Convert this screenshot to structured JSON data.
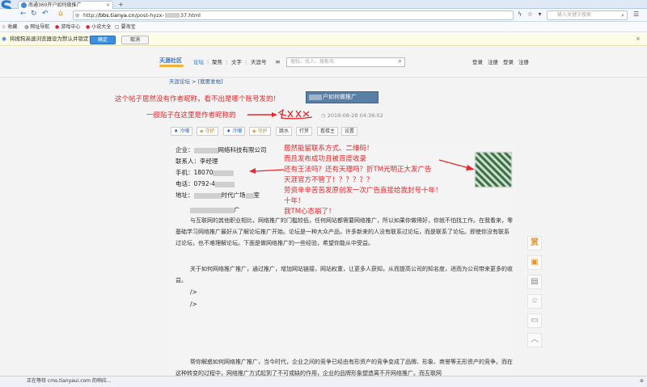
{
  "browser": {
    "tab_title": "南通360开户如何做推广",
    "new_tab": "+",
    "url_prefix": "http://",
    "url_domain": "bbs.tianya.cn",
    "url_path": "/post-hyzx-",
    "url_suffix": "37.html",
    "search_placeholder": "输入关键字搜索",
    "nav_back": "←",
    "nav_forward": "→",
    "nav_refresh": "↻",
    "nav_undo": "↶",
    "nav_home": "⌂"
  },
  "bookmarks": [
    {
      "label": "收藏"
    },
    {
      "label": "网址导航"
    },
    {
      "label": "游戏中心"
    },
    {
      "label": "小说大全"
    },
    {
      "label": "要淘宝"
    }
  ],
  "infobar": {
    "message": "将搜狗高速浏览器设为默认并锁定？",
    "ok_label": "确定",
    "cancel_label": "取消"
  },
  "tianya": {
    "logo_text": "天涯社区",
    "nav": [
      "论坛",
      "聚焦",
      "文字",
      "天涯号"
    ],
    "menu_icon": "≡",
    "search_placeholder": "搜帖、找人、搜板块",
    "right_links": [
      "登录",
      "注册",
      "登录",
      "注册"
    ],
    "breadcrumb_home": "天涯论坛",
    "breadcrumb_sep": " > ",
    "breadcrumb_section": "[我要发帖]",
    "post_title": "户如何做推广",
    "post_time": "2019-08-28 04:36:02"
  },
  "toolbar": [
    "冷嘲",
    "守护",
    "冷嘲",
    "守护",
    "跳水",
    "打赏",
    "看楼主",
    "设置"
  ],
  "annotations": {
    "no_author": "这个帖子居然没有作者昵称，看不出是哪个账号发的！",
    "author_here": "一般贴子在这里是作者昵称的",
    "contact_lines": [
      "居然能留联系方式、二维码！",
      "而且发布成功且被百度收录",
      "还有王法吗？还有天理吗？折TM光明正大发广告",
      "天涯官方不管了！？？？？？",
      "劳资辛辛苦苦发原创发一次广告直接给我封号十年！",
      "十年！",
      "我TM心态崩了！"
    ]
  },
  "contact": {
    "company_label": "企业：",
    "company_value": "网络科技有限公司",
    "contact_label": "联系人：李经理",
    "phone_label": "手机：18070",
    "tel_label": "电话：0792-4",
    "address_label": "地址：",
    "address_mid": "时代广场",
    "address_end": "室",
    "extra_line": "广"
  },
  "body": {
    "p1": "与互联网的其他职业相比，网络推广的门槛较低，任何网站都需要网络推广，所以如果你做得好，你就不怕找工作。在我看来，零基础学习网络推广最好从了解论坛推广开始。论坛是一种大众产品，许多新来的人没有联系过论坛，而是联系了论坛。即使你没有联系过论坛，也不难理解论坛。下面是做网络推广的一些经验，希望你能从中受益。",
    "p2": "关于如何网络推广推广，通过推广，增加网站链接，网站权重，让更多人获知，从而提高公司的知名度，进而为公司带来更多的收益。",
    "tag1": "/>",
    "tag2": "/>",
    "p3": "帮你解惑如何网络推广推广，当今时代，企业之间的竞争已经由有形资产的竞争变成了品牌、形象、商誉等无形资产的竞争。而在这种转变的过程中，网络推广方式起到了不可或缺的作用，企业的品牌形象塑造离不开网络推广。而互联网"
  },
  "sidebar": [
    "赏",
    "▣",
    "▤",
    "☆",
    "▭",
    "︿"
  ],
  "status": {
    "text": "正在等待 cms.tianyaui.com 的响应...",
    "right": "⊕"
  },
  "colors": {
    "annotation_red": "#e8262b",
    "link_blue": "#2a5a9a"
  }
}
